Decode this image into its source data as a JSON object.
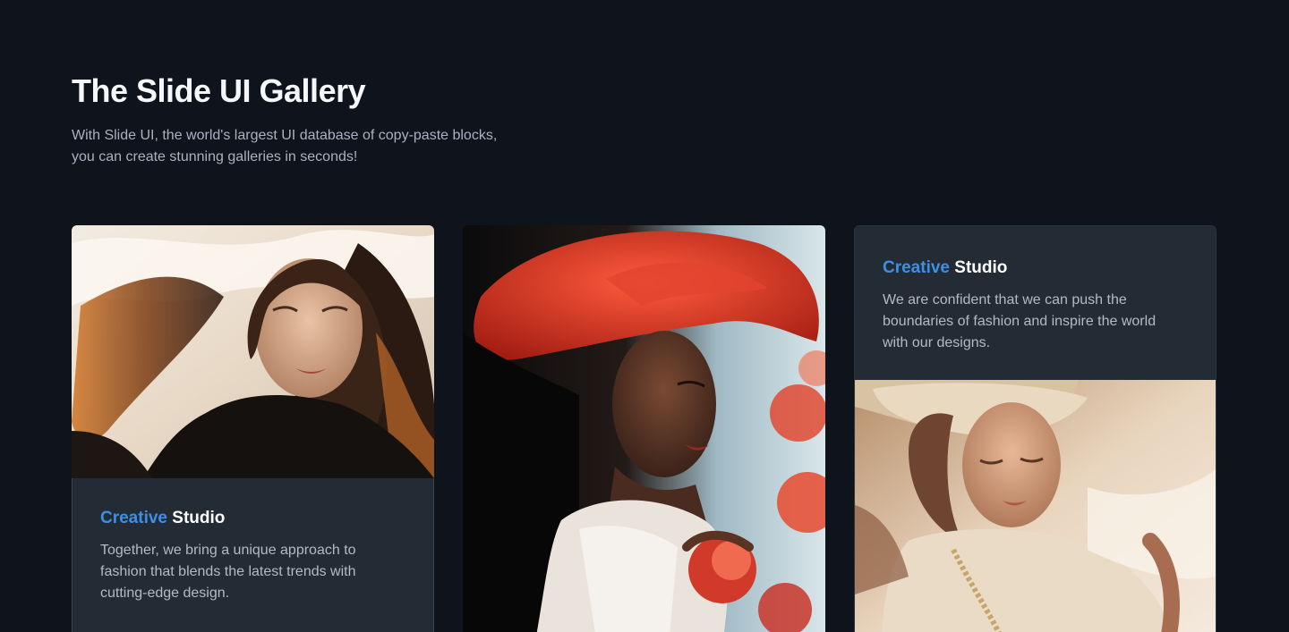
{
  "header": {
    "title": "The Slide UI Gallery",
    "subtitle_line1": "With Slide UI, the world's largest UI database of copy-paste blocks,",
    "subtitle_line2": "you can create stunning galleries in seconds!"
  },
  "cards": [
    {
      "title_accent": "Creative",
      "title_rest": "Studio",
      "text": "Together, we bring a unique approach to fashion that blends the latest trends with cutting-edge design.",
      "image": "portrait-woman-flowing-hair"
    },
    {
      "image": "portrait-woman-red-hat-roses"
    },
    {
      "title_accent": "Creative",
      "title_rest": "Studio",
      "text": "We are confident that we can push the boundaries of fashion and inspire the world with our designs.",
      "image": "portrait-woman-cream-hat"
    }
  ],
  "colors": {
    "background": "#0e131c",
    "card_panel": "#232b35",
    "accent": "#3d8fe6"
  }
}
